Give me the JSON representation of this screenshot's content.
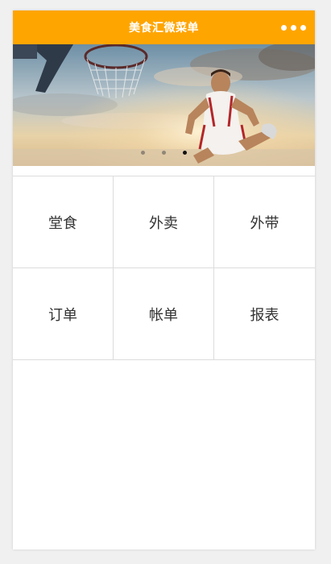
{
  "navbar": {
    "title": "美食汇微菜单",
    "menu_icon": "more-dots-icon",
    "color": "#ffa500"
  },
  "banner": {
    "image": "basketball-player-dunk",
    "indicator_count": 3,
    "active_index": 2
  },
  "grid": [
    [
      {
        "label": "堂食"
      },
      {
        "label": "外卖"
      },
      {
        "label": "外带"
      }
    ],
    [
      {
        "label": "订单"
      },
      {
        "label": "帐单"
      },
      {
        "label": "报表"
      }
    ]
  ]
}
